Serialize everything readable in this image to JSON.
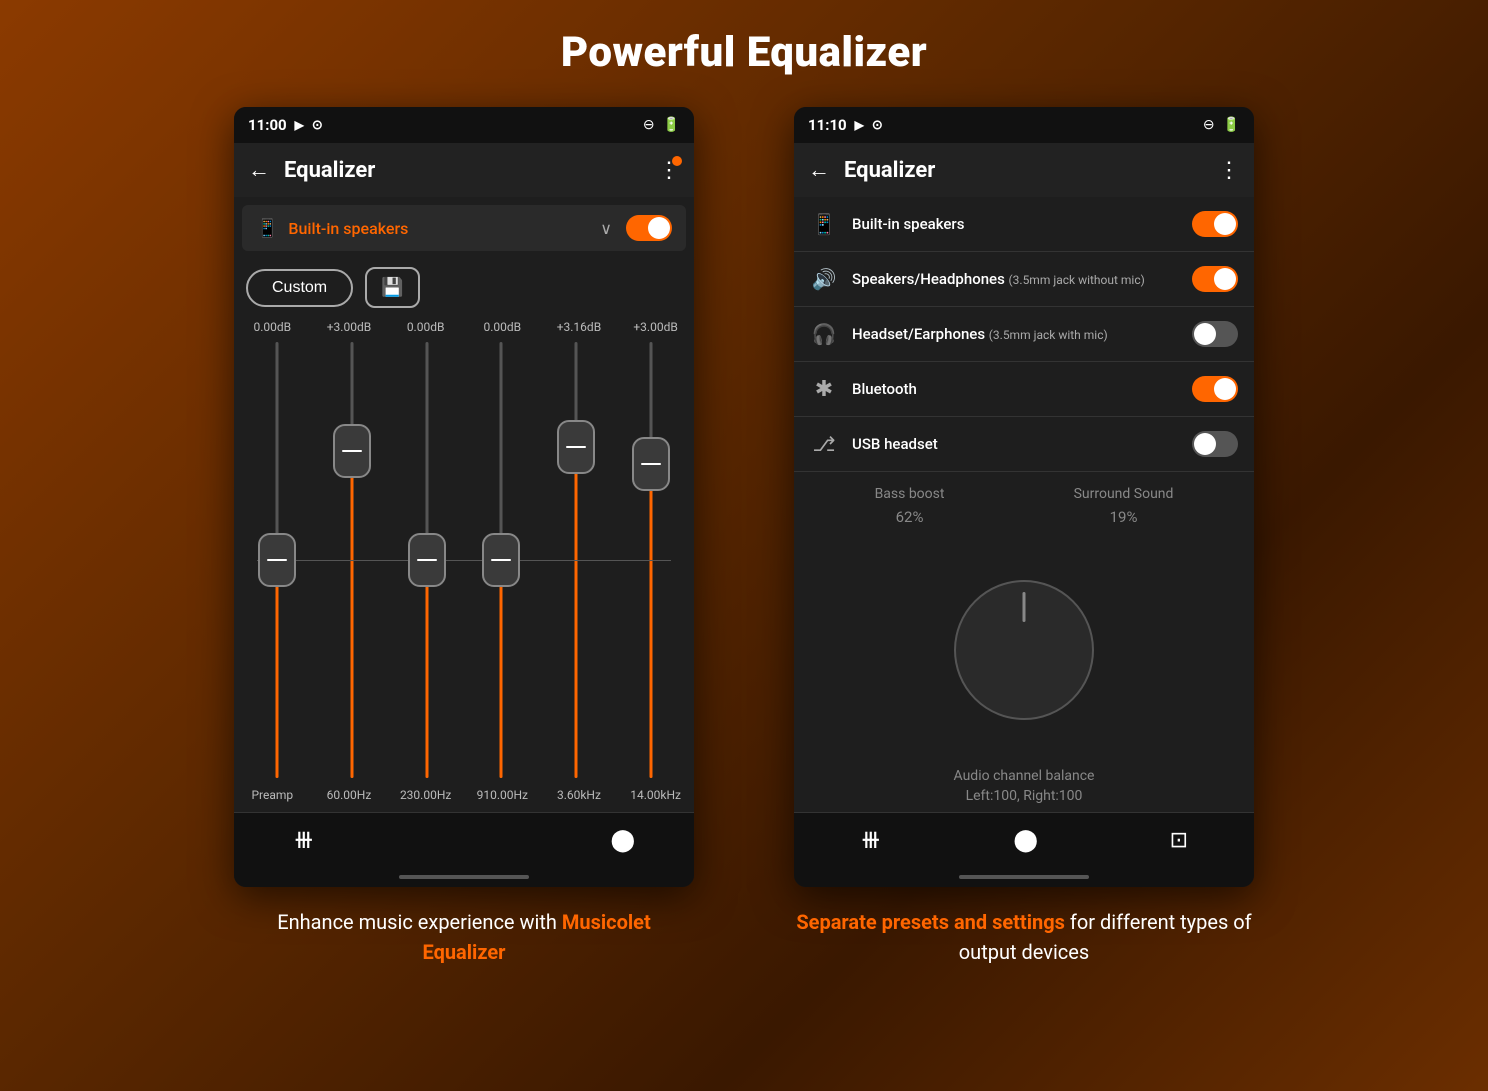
{
  "page": {
    "title": "Powerful Equalizer"
  },
  "phone1": {
    "status": {
      "time": "11:00",
      "right_icons": "⊖ 🔋"
    },
    "topbar": {
      "title": "Equalizer"
    },
    "device": {
      "name": "Built-in speakers",
      "toggle_state": "on"
    },
    "preset": {
      "label": "Custom",
      "save_label": "💾"
    },
    "bands": [
      {
        "db": "0.00dB",
        "freq": "Preamp",
        "position": 50
      },
      {
        "db": "+3.00dB",
        "freq": "60.00Hz",
        "position": 25
      },
      {
        "db": "0.00dB",
        "freq": "230.00Hz",
        "position": 50
      },
      {
        "db": "0.00dB",
        "freq": "910.00Hz",
        "position": 50
      },
      {
        "db": "+3.16dB",
        "freq": "3.60kHz",
        "position": 25
      },
      {
        "db": "+3.00dB",
        "freq": "14.00kHz",
        "position": 30
      }
    ],
    "nav": {
      "eq_icon": "⧾",
      "settings_icon": "⬤"
    },
    "caption": {
      "text_plain": "Enhance music experience with ",
      "text_highlight": "Musicolet Equalizer",
      "highlight_color": "#FF6600"
    }
  },
  "phone2": {
    "status": {
      "time": "11:10"
    },
    "topbar": {
      "title": "Equalizer"
    },
    "outputs": [
      {
        "icon": "📱",
        "name": "Built-in speakers",
        "subtitle": "",
        "toggle": "on",
        "icon_color": "orange"
      },
      {
        "icon": "🔊",
        "name": "Speakers/Headphones",
        "subtitle": "(3.5mm jack without mic)",
        "toggle": "on",
        "icon_color": "gray"
      },
      {
        "icon": "🎧",
        "name": "Headset/Earphones",
        "subtitle": "(3.5mm jack with mic)",
        "toggle": "off",
        "icon_color": "gray"
      },
      {
        "icon": "✴",
        "name": "Bluetooth",
        "subtitle": "",
        "toggle": "on",
        "icon_color": "gray"
      },
      {
        "icon": "⎇",
        "name": "USB headset",
        "subtitle": "",
        "toggle": "off",
        "icon_color": "gray"
      }
    ],
    "bass_boost": {
      "label": "Bass boost",
      "value": "62%"
    },
    "surround": {
      "label": "Surround Sound",
      "value": "19%"
    },
    "knob": {
      "label": "Audio channel balance",
      "value": "Left:100, Right:100"
    },
    "nav": {
      "eq_icon": "⧾",
      "circle_icon": "⬤",
      "camera_icon": "📷"
    },
    "caption": {
      "text_highlight": "Separate presets and settings",
      "text_plain": " for different types of output devices",
      "highlight_color": "#FF6600"
    }
  }
}
